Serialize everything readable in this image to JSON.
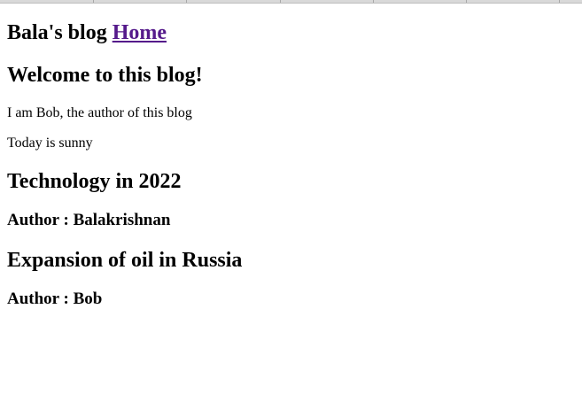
{
  "site": {
    "title": "Bala's blog",
    "home_link": "Home"
  },
  "welcome": {
    "heading": "Welcome to this blog!",
    "intro": "I am Bob, the author of this blog",
    "weather": "Today is sunny"
  },
  "posts": [
    {
      "title": "Technology in 2022",
      "author": "Author : Balakrishnan"
    },
    {
      "title": "Expansion of oil in Russia",
      "author": "Author : Bob"
    }
  ],
  "colors": {
    "visited_link": "#551a8b"
  }
}
